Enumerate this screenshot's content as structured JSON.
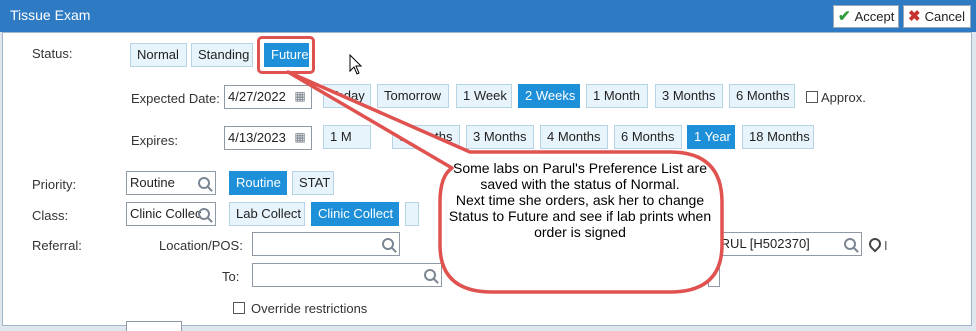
{
  "window": {
    "title": "Tissue Exam",
    "accept_label": "Accept",
    "cancel_label": "Cancel"
  },
  "status": {
    "label": "Status:",
    "options": [
      "Normal",
      "Standing",
      "Future"
    ],
    "selected": "Future"
  },
  "expected_date": {
    "label": "Expected Date:",
    "value": "4/27/2022",
    "quick": [
      "Today",
      "Tomorrow",
      "1 Week",
      "2 Weeks",
      "1 Month",
      "3 Months",
      "6 Months"
    ],
    "selected": "2 Weeks",
    "approx_label": "Approx."
  },
  "expires": {
    "label": "Expires:",
    "value": "4/13/2023",
    "quick": [
      "1 M",
      "3 Months",
      "3 Months",
      "4 Months",
      "6 Months",
      "1 Year",
      "18 Months"
    ],
    "selected": "1 Year"
  },
  "priority": {
    "label": "Priority:",
    "value": "Routine",
    "options": [
      "Routine",
      "STAT"
    ],
    "selected": "Routine"
  },
  "class": {
    "label": "Class:",
    "value": "Clinic Collec",
    "options": [
      "Lab Collect",
      "Clinic Collect"
    ],
    "selected": "Clinic Collect"
  },
  "referral": {
    "label": "Referral:",
    "location_label": "Location/POS:",
    "location_value": "",
    "to_label": "To:",
    "to_value": "",
    "provider_value": "ARUL [H502370]"
  },
  "override_label": "Override restrictions",
  "callout_text": "Some labs on Parul's Preference List are saved with the status of Normal.\nNext time she orders, ask her to change Status to Future and see if lab prints when order is signed",
  "colors": {
    "accent": "#1e8fd9",
    "titlebar": "#2e7bc4",
    "callout_border": "#e0524f"
  }
}
